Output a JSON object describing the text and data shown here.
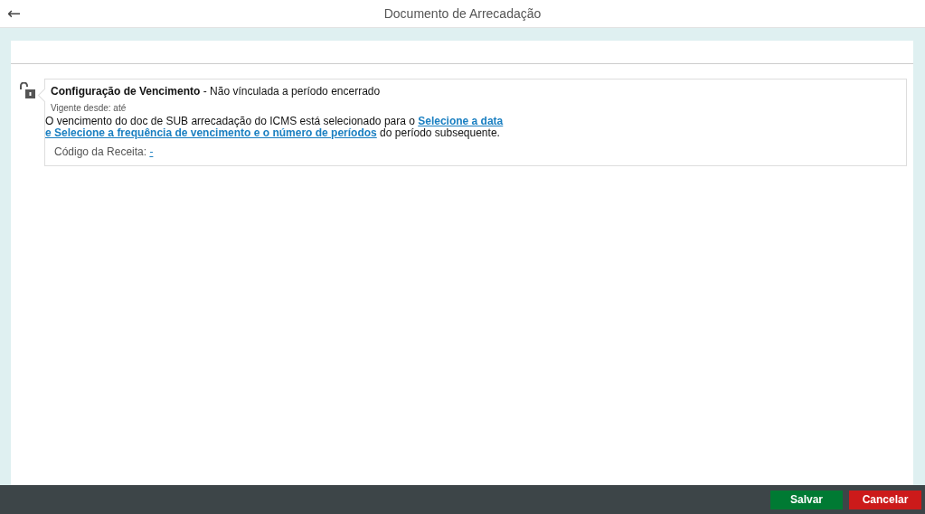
{
  "header": {
    "back": "←",
    "title": "Documento de Arrecadação"
  },
  "card": {
    "title": "Configuração de Vencimento",
    "subtitle": " - Não vínculada a período encerrado",
    "locked": false,
    "validity": "Vigente desde: até",
    "sentence_start": "O vencimento do doc de SUB arrecadação do ICMS está selecionado para o ",
    "link_1": "Selecione a data",
    "link_2": "e Selecione a frequência de vencimento e o número de períodos",
    "sentence_end": " do período subsequente.",
    "code_label": "Código da Receita: ",
    "code_value": "-"
  },
  "footer": {
    "buttons": [
      {
        "label": "Salvar",
        "kind": "primary"
      },
      {
        "label": "Cancelar",
        "kind": "danger"
      }
    ]
  }
}
